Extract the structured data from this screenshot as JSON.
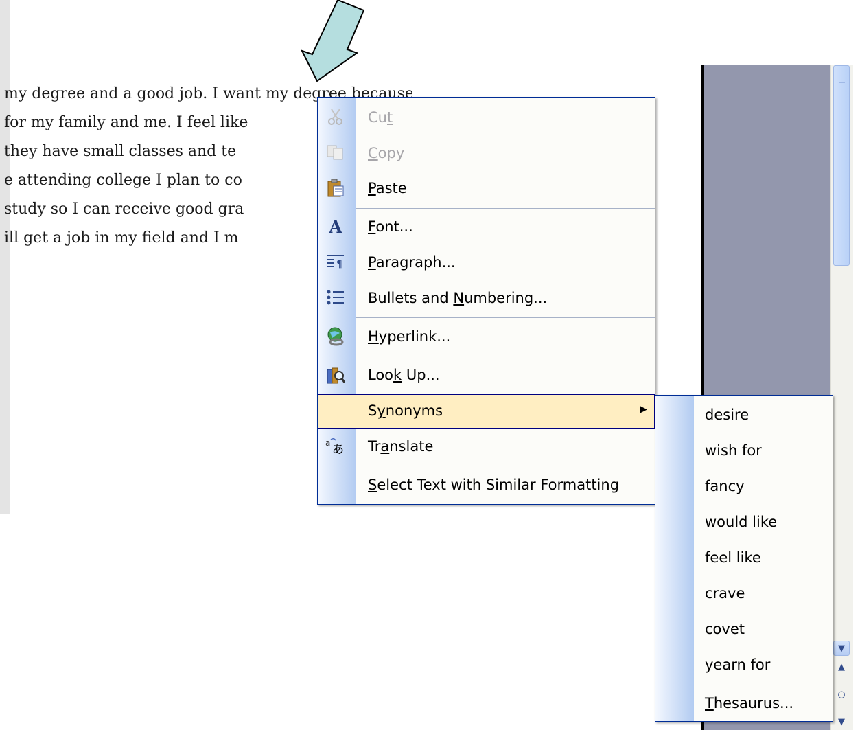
{
  "document": {
    "lines": [
      "my degree and a good job. I want my degree because",
      "for my family and me. I feel like",
      "they have small classes and te",
      "e attending college I plan to co",
      "study so I can receive good gra",
      "ill get a job in my field and I m"
    ]
  },
  "context_menu": {
    "items": {
      "cut": {
        "pre": "Cu",
        "acc": "t",
        "post": "",
        "icon": "scissors-icon",
        "disabled": true
      },
      "copy": {
        "pre": "",
        "acc": "C",
        "post": "opy",
        "icon": "copy-icon",
        "disabled": true
      },
      "paste": {
        "pre": "",
        "acc": "P",
        "post": "aste",
        "icon": "clipboard-icon",
        "disabled": false
      },
      "font": {
        "pre": "",
        "acc": "F",
        "post": "ont...",
        "icon": "font-icon",
        "disabled": false
      },
      "paragraph": {
        "pre": "",
        "acc": "P",
        "post": "aragraph...",
        "icon": "paragraph-icon",
        "disabled": false
      },
      "bullets": {
        "pre": "Bullets and ",
        "acc": "N",
        "post": "umbering...",
        "icon": "bullets-icon",
        "disabled": false
      },
      "hyperlink": {
        "pre": "",
        "acc": "H",
        "post": "yperlink...",
        "icon": "globe-link-icon",
        "disabled": false
      },
      "lookup": {
        "pre": "Loo",
        "acc": "k",
        "post": " Up...",
        "icon": "research-icon",
        "disabled": false
      },
      "synonyms": {
        "pre": "S",
        "acc": "y",
        "post": "nonyms",
        "icon": "",
        "disabled": false,
        "highlighted": true
      },
      "translate": {
        "pre": "Tr",
        "acc": "a",
        "post": "nslate",
        "icon": "translate-icon",
        "disabled": false
      },
      "select_similar": {
        "pre": "",
        "acc": "S",
        "post": "elect Text with Similar Formatting",
        "icon": "",
        "disabled": false
      }
    }
  },
  "synonyms_menu": {
    "items": [
      "desire",
      "wish for",
      "fancy",
      "would like",
      "feel like",
      "crave",
      "covet",
      "yearn for"
    ],
    "thesaurus": {
      "pre": "",
      "acc": "T",
      "post": "hesaurus..."
    }
  },
  "colors": {
    "menu_border": "#002d96",
    "highlight_bg": "#ffeec2",
    "side_panel": "#9397ad",
    "arrow_fill": "#b5dedf"
  }
}
